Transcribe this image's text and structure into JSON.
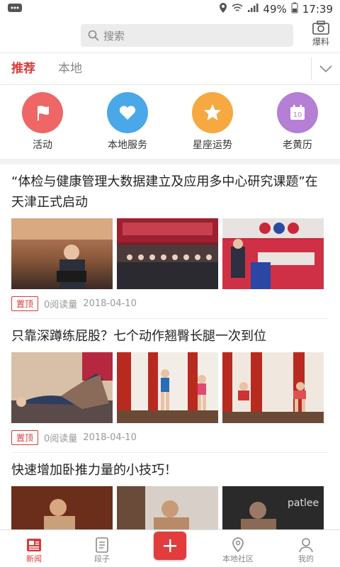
{
  "status": {
    "battery": "49%",
    "time": "17:39"
  },
  "header": {
    "search_placeholder": "搜索",
    "report_label": "爆料"
  },
  "tabs": [
    {
      "label": "推荐"
    },
    {
      "label": "本地"
    }
  ],
  "shortcuts": [
    {
      "label": "活动",
      "color": "#ee6666",
      "icon": "flag-icon"
    },
    {
      "label": "本地服务",
      "color": "#4aa8e8",
      "icon": "heart-icon"
    },
    {
      "label": "星座运势",
      "color": "#f5a940",
      "icon": "star-icon"
    },
    {
      "label": "老黄历",
      "color": "#b57fd6",
      "icon": "calendar-icon"
    }
  ],
  "articles": [
    {
      "title": "“体检与健康管理大数据建立及应用多中心研究课题”在天津正式启动",
      "badge": "置顶",
      "reads": "0阅读量",
      "date": "2018-04-10"
    },
    {
      "title": "只靠深蹲练屁股？七个动作翘臀长腿一次到位",
      "badge": "置顶",
      "reads": "0阅读量",
      "date": "2018-04-10"
    },
    {
      "title": "快速增加卧推力量的小技巧！"
    }
  ],
  "bottom_nav": [
    {
      "label": "新闻"
    },
    {
      "label": "段子"
    },
    {
      "label": ""
    },
    {
      "label": "本地社区"
    },
    {
      "label": "我的"
    }
  ],
  "colors": {
    "accent": "#d93a3a"
  }
}
